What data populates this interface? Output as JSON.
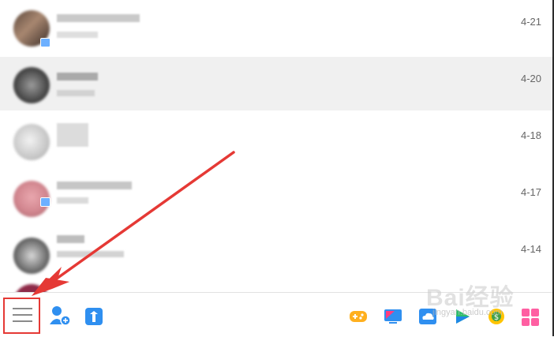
{
  "conversations": [
    {
      "date": "4-21"
    },
    {
      "date": "4-20"
    },
    {
      "date": "4-18"
    },
    {
      "date": "4-17"
    },
    {
      "date": "4-14"
    }
  ],
  "colors": {
    "selected_row": "#f0f0f0",
    "highlight_box": "#e53935",
    "arrow": "#e53935"
  },
  "toolbar": {
    "left_icons": [
      "menu-icon",
      "add-friend-icon",
      "mail-icon"
    ],
    "right_icons": [
      "game-icon",
      "video-icon",
      "cloud-icon",
      "play-icon",
      "coin-icon",
      "app-grid-icon"
    ]
  },
  "watermark": {
    "text": "Bai经验",
    "subtext": "jingyan.baidu.com"
  }
}
